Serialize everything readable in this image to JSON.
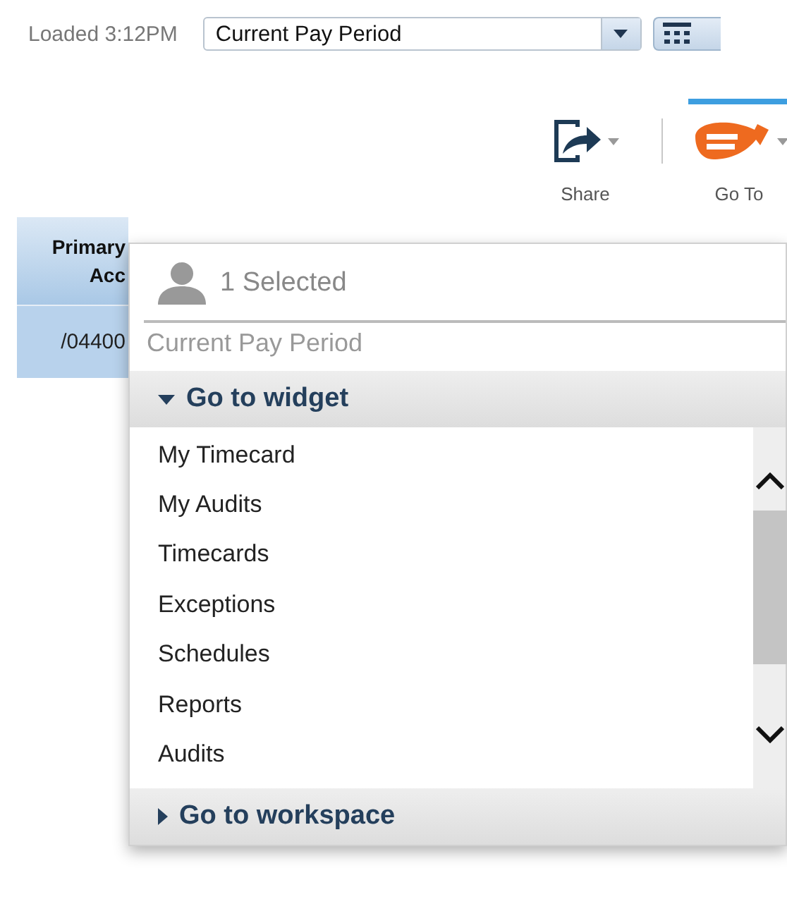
{
  "top_bar": {
    "loaded": "Loaded 3:12PM",
    "period_select": {
      "value": "Current Pay Period"
    }
  },
  "toolbar": [
    {
      "label": "Share",
      "kind": "share",
      "selected": false
    },
    {
      "label": "Go To",
      "kind": "goto",
      "selected": true
    }
  ],
  "table": {
    "columns": [
      [
        "Primary",
        "Acc"
      ]
    ],
    "rows": [
      [
        "/04400"
      ]
    ]
  },
  "goto_popup": {
    "selection": "1 Selected",
    "period": "Current Pay Period",
    "sections": [
      {
        "title": "Go to widget",
        "expanded": true,
        "items": [
          "My Timecard",
          "My Audits",
          "Timecards",
          "Exceptions",
          "Schedules",
          "Reports",
          "Audits"
        ]
      },
      {
        "title": "Go to workspace",
        "expanded": false
      }
    ]
  }
}
